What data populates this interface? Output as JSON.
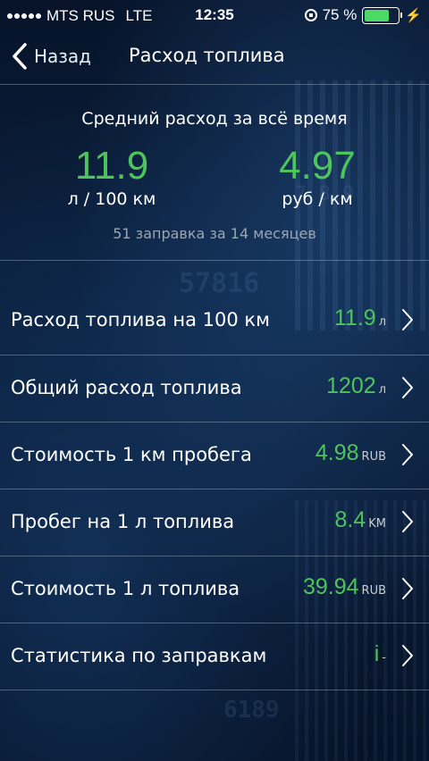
{
  "status_bar": {
    "carrier": "MTS RUS",
    "network": "LTE",
    "time": "12:35",
    "battery_percent": "75 %",
    "battery_level": 0.75,
    "icons": [
      "signal-dots-icon",
      "rotation-lock-icon",
      "battery-icon",
      "charging-bolt-icon"
    ]
  },
  "nav": {
    "back_label": "Назад",
    "title": "Расход топлива",
    "back_icon": "chevron-left-icon"
  },
  "summary": {
    "title": "Средний расход за всё время",
    "left_value": "11.9",
    "left_unit": "л / 100 км",
    "right_value": "4.97",
    "right_unit": "руб / км",
    "subtitle": "51 заправка за 14 месяцев"
  },
  "rows": [
    {
      "label": "Расход топлива на 100 км",
      "value": "11.9",
      "unit": "л"
    },
    {
      "label": "Общий расход топлива",
      "value": "1202",
      "unit": "л"
    },
    {
      "label": "Стоимость 1 км пробега",
      "value": "4.98",
      "unit": "RUB"
    },
    {
      "label": "Пробег на 1 л топлива",
      "value": "8.4",
      "unit": "KM"
    },
    {
      "label": "Стоимость 1 л топлива",
      "value": "39.94",
      "unit": "RUB"
    },
    {
      "label": "Статистика по заправкам",
      "value": "i",
      "unit": "-"
    }
  ],
  "colors": {
    "accent_green": "#4fc35c",
    "battery_green": "#4cd964",
    "background": "#0a1e3a"
  }
}
